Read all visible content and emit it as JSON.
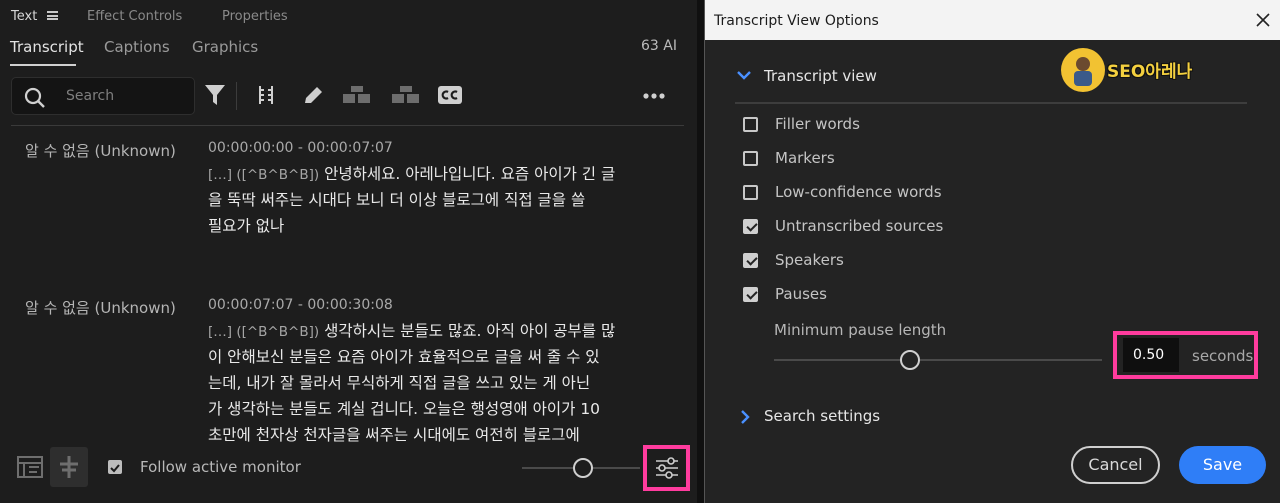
{
  "panel_tabs": {
    "text": "Text",
    "effect_controls": "Effect Controls",
    "properties": "Properties"
  },
  "subtabs": {
    "transcript": "Transcript",
    "captions": "Captions",
    "graphics": "Graphics",
    "ai_count": "63 AI"
  },
  "search": {
    "placeholder": "Search"
  },
  "toolbar_icons": [
    "filter-icon",
    "split-icon",
    "pencil-icon",
    "merge-clips-icon",
    "split-clips-icon",
    "cc-icon",
    "more-icon"
  ],
  "transcript": [
    {
      "speaker": "알 수 없음 (Unknown)",
      "time": "00:00:00:00 - 00:00:07:07",
      "tag": "[…] ([^B^B^B])",
      "lines": [
        "안녕하세요. 아레나입니다. 요즘 아이가 긴 글",
        "을 뚝딱 써주는 시대다 보니 더 이상 블로그에 직접 글을 쓸",
        "필요가 없나"
      ]
    },
    {
      "speaker": "알 수 없음 (Unknown)",
      "time": "00:00:07:07 - 00:00:30:08",
      "tag": "[…] ([^B^B^B])",
      "lines": [
        "생각하시는 분들도 많죠. 아직 아이 공부를 많",
        "이 안해보신 분들은 요즘 아이가 효율적으로 글을 써 줄 수 있",
        "는데, 내가 잘 몰라서 무식하게 직접 글을 쓰고 있는 게 아닌",
        "가 생각하는 분들도 계실 겁니다. 오늘은 행성영애 아이가 10",
        "초만에 천자상 천자글을 써주는 시대에도 여전히 블로그에"
      ]
    }
  ],
  "bottom": {
    "follow_label": "Follow active monitor",
    "follow_checked": true
  },
  "dialog": {
    "title": "Transcript View Options",
    "section_view": "Transcript view",
    "options": [
      {
        "label": "Filler words",
        "checked": false
      },
      {
        "label": "Markers",
        "checked": false
      },
      {
        "label": "Low-confidence words",
        "checked": false
      },
      {
        "label": "Untranscribed sources",
        "checked": true
      },
      {
        "label": "Speakers",
        "checked": true
      },
      {
        "label": "Pauses",
        "checked": true
      }
    ],
    "min_pause_label": "Minimum pause length",
    "min_pause_value": "0.50",
    "min_pause_unit": "seconds",
    "section_search": "Search settings",
    "cancel": "Cancel",
    "save": "Save"
  },
  "watermark": "SEO아레나",
  "colors": {
    "highlight": "#ff3c9e",
    "primary_button": "#2f7ef7",
    "chevron": "#4a90ff"
  }
}
